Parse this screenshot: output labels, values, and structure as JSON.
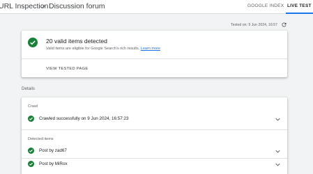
{
  "header": {
    "crumb_parent": "URL Inspection",
    "crumb_separator": ">",
    "crumb_current": "Discussion forum",
    "tabs": [
      {
        "label": "GOOGLE INDEX",
        "active": false
      },
      {
        "label": "LIVE TEST",
        "active": true
      }
    ]
  },
  "tested_on": "Tested on: 9 Jun 2024, 16:57",
  "summary": {
    "title": "20 valid items detected",
    "subtitle": "Valid items are eligible for Google Search's rich results.",
    "learn_more": "Learn more",
    "view_tested_page": "VIEW TESTED PAGE"
  },
  "details_label": "Details",
  "crawl": {
    "section": "Crawl",
    "status": "Crawled successfully on 9 Jun 2024, 16:57:23"
  },
  "detected": {
    "section": "Detected items",
    "items": [
      {
        "label": "Post by zad67"
      },
      {
        "label": "Post by MiRox"
      }
    ]
  },
  "colors": {
    "accent": "#1a73e8",
    "success": "#188038",
    "background": "#f1f3f4"
  }
}
